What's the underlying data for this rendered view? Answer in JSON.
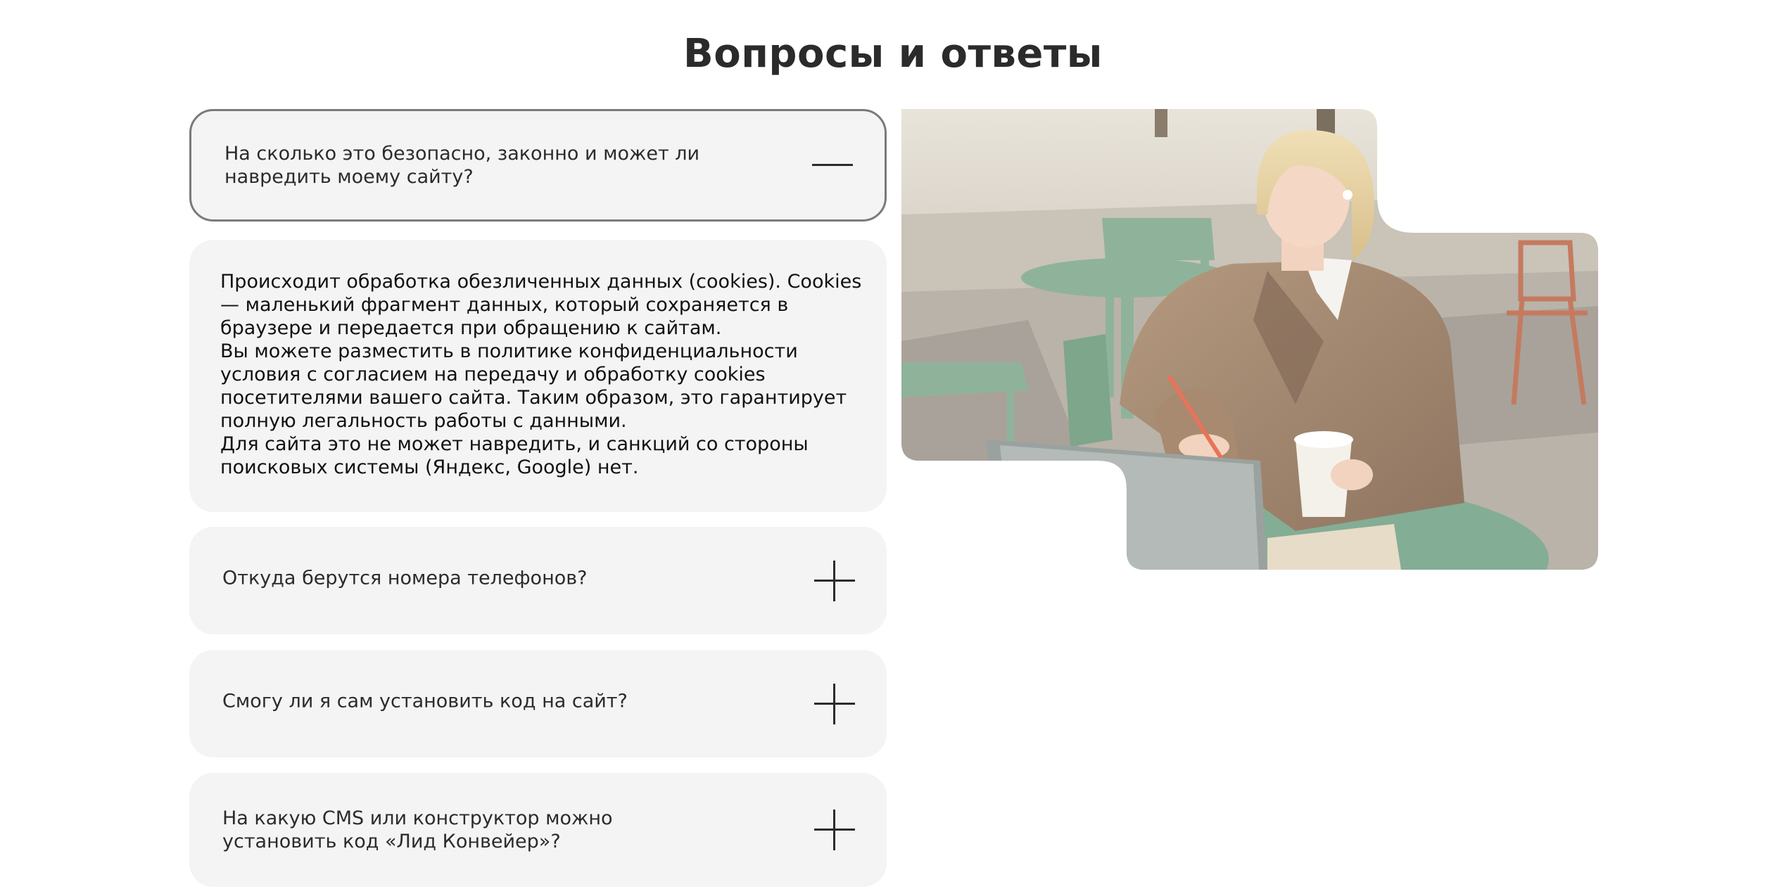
{
  "page": {
    "title": "Вопросы и ответы"
  },
  "faq": [
    {
      "question": "На сколько это безопасно, законно и может ли навредить моему сайту?",
      "expanded": true,
      "toggle_icon": "minus-icon",
      "answer": [
        "Происходит обработка обезличенных данных (cookies). Cookies — маленький фрагмент данных, который сохраняется в браузере и передается при обращению к сайтам.",
        "Вы можете разместить в политике конфиденциальности условия с согласием на передачу и обработку cookies посетителями вашего сайта. Таким образом, это гарантирует полную легальность работы с данными.",
        "Для сайта это не может навредить, и санкций со стороны поисковых системы (Яндекс, Google) нет."
      ]
    },
    {
      "question": "Откуда берутся номера телефонов?",
      "expanded": false,
      "toggle_icon": "plus-icon"
    },
    {
      "question": "Смогу ли я сам установить код на сайт?",
      "expanded": false,
      "toggle_icon": "plus-icon"
    },
    {
      "question": "На какую CMS или конструктор можно установить код «Лид Конвейер»?",
      "expanded": false,
      "toggle_icon": "plus-icon"
    }
  ],
  "colors": {
    "card_bg": "#f4f4f4",
    "text": "#2b2b2b",
    "active_border": "#7a7a7a"
  }
}
